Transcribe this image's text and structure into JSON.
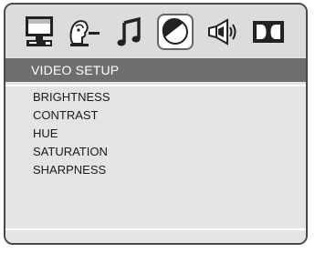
{
  "tabs": [
    {
      "icon": "system-setup-icon",
      "active": false
    },
    {
      "icon": "language-setup-icon",
      "active": false
    },
    {
      "icon": "audio-setup-icon",
      "active": false
    },
    {
      "icon": "video-setup-icon",
      "active": true
    },
    {
      "icon": "speaker-setup-icon",
      "active": false
    },
    {
      "icon": "dolby-digital-icon",
      "active": false
    }
  ],
  "menu": {
    "title": "VIDEO SETUP",
    "items": [
      "BRIGHTNESS",
      "CONTRAST",
      "HUE",
      "SATURATION",
      "SHARPNESS"
    ]
  },
  "colors": {
    "header_bg": "#6f6f6f",
    "panel_bg": "#e4e4e4",
    "frame_border": "#4a4a4a"
  }
}
